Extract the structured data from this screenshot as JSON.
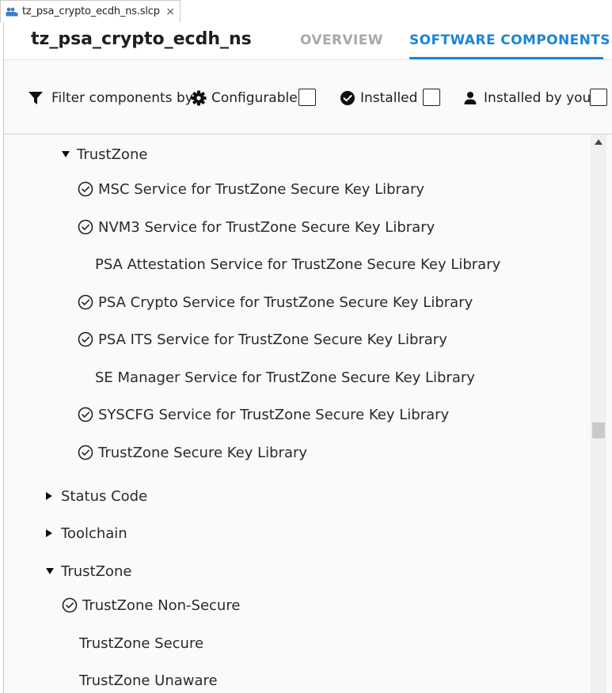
{
  "tab": {
    "label": "tz_psa_crypto_ecdh_ns.slcp",
    "close_glyph": "×"
  },
  "header": {
    "title": "tz_psa_crypto_ecdh_ns",
    "tabs": [
      {
        "label": "OVERVIEW",
        "active": false
      },
      {
        "label": "SOFTWARE COMPONENTS",
        "active": true
      }
    ],
    "accent_color": "#1a86d6"
  },
  "filter": {
    "label": "Filter components by",
    "options": [
      {
        "label": "Configurable",
        "icon": "gear-icon",
        "checked": false
      },
      {
        "label": "Installed",
        "icon": "check-circle-icon",
        "checked": false
      },
      {
        "label": "Installed by you",
        "icon": "person-icon",
        "checked": false
      }
    ]
  },
  "tree": {
    "sections": [
      {
        "label": "TrustZone",
        "expanded": true,
        "items": [
          {
            "label": "MSC Service for TrustZone Secure Key Library",
            "installed": true
          },
          {
            "label": "NVM3 Service for TrustZone Secure Key Library",
            "installed": true
          },
          {
            "label": "PSA Attestation Service for TrustZone Secure Key Library",
            "installed": false
          },
          {
            "label": "PSA Crypto Service for TrustZone Secure Key Library",
            "installed": true
          },
          {
            "label": "PSA ITS Service for TrustZone Secure Key Library",
            "installed": true
          },
          {
            "label": "SE Manager Service for TrustZone Secure Key Library",
            "installed": false
          },
          {
            "label": "SYSCFG Service for TrustZone Secure Key Library",
            "installed": true
          },
          {
            "label": "TrustZone Secure Key Library",
            "installed": true
          }
        ]
      },
      {
        "label": "Status Code",
        "expanded": false
      },
      {
        "label": "Toolchain",
        "expanded": false
      },
      {
        "label": "TrustZone",
        "expanded": true,
        "items": [
          {
            "label": "TrustZone Non-Secure",
            "installed": true
          },
          {
            "label": "TrustZone Secure",
            "installed": false
          },
          {
            "label": "TrustZone Unaware",
            "installed": false
          }
        ]
      }
    ]
  }
}
